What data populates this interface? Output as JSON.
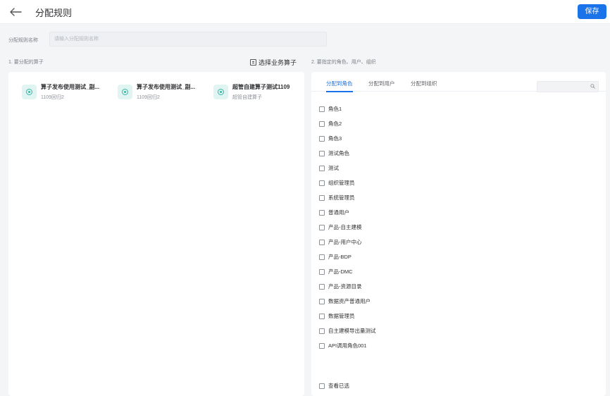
{
  "header": {
    "title": "分配规则",
    "save_label": "保存"
  },
  "form": {
    "name_label": "分配规则名称",
    "name_placeholder": "请输入分配规则名称",
    "name_value": ""
  },
  "left": {
    "section_title": "1. 要分配的算子",
    "select_button_label": "选择业务算子",
    "operators": [
      {
        "name": "算子发布使用测试_副...",
        "sub": "1109回归2"
      },
      {
        "name": "算子发布使用测试_副...",
        "sub": "1109回归2"
      },
      {
        "name": "超管自建算子测试1109",
        "sub": "超管自建算子"
      }
    ]
  },
  "right": {
    "section_title": "2. 要指定的角色、用户、组织",
    "tabs": [
      {
        "label": "分配到角色",
        "active": true
      },
      {
        "label": "分配到用户",
        "active": false
      },
      {
        "label": "分配到组织",
        "active": false
      }
    ],
    "search_placeholder": "",
    "roles": [
      "角色1",
      "角色2",
      "角色3",
      "测试角色",
      "测试",
      "组织管理员",
      "系统管理员",
      "普通用户",
      "产品-自主建模",
      "产品-用户中心",
      "产品-BDP",
      "产品-DMC",
      "产品-资源目录",
      "数据资产普通用户",
      "数据管理员",
      "自主建模导出量测试",
      "API调用角色001"
    ],
    "view_selected_label": "查看已选"
  },
  "colors": {
    "primary": "#1a73e8",
    "operator_icon": "#3ab5a6"
  }
}
